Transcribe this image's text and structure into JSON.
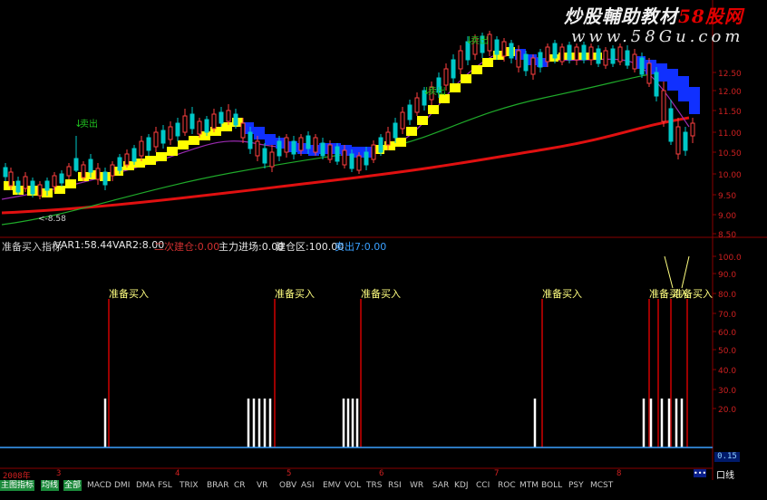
{
  "watermark": {
    "line1_white": "炒股輔助教材",
    "line1_red": "58股网",
    "line2": "www.58Gu.com"
  },
  "colors": {
    "up_candle": "#00c8c8",
    "down_candle": "#ff4040",
    "ma_red": "#e01010",
    "ma_green": "#1faa2a",
    "ma_purple": "#9a2ab0",
    "yellow_band": "#ffff00",
    "blue_band": "#1030ff",
    "signal_white": "#ffffff",
    "signal_red": "#d00000",
    "label_yellow": "#ffff80",
    "buy_green": "#20c020",
    "baseline": "#3aa0ff",
    "grid_red": "#8a0000"
  },
  "price_axis": [
    "12.50",
    "12.00",
    "11.50",
    "11.00",
    "10.50",
    "10.00",
    "9.50",
    "9.00",
    "8.50"
  ],
  "price_note": "<-8.58",
  "sell_labels": [
    "卖出",
    "卖出",
    "卖出"
  ],
  "indicator_header": {
    "title": "准备买入指标",
    "var1": "VAR1:58.44",
    "var2": "VAR2:8.00",
    "item3": "二次建仓:0.00",
    "item4": "主力进场:0.00",
    "item5": "建仓区:100.00",
    "item6": "卖出7:0.00"
  },
  "indicator_axis": [
    "100.0",
    "90.0",
    "80.0",
    "70.0",
    "60.0",
    "50.0",
    "40.0",
    "30.0",
    "20.0"
  ],
  "buy_labels": [
    "准备买入",
    "准备买入",
    "准备买入",
    "准备买入",
    "准备买入",
    "准备买入"
  ],
  "cursor_value": "0.15",
  "date_axis": {
    "year": "2008年",
    "months": [
      "3",
      "4",
      "5",
      "6",
      "7",
      "8"
    ]
  },
  "window_label": "口线",
  "scroll_button": "•••",
  "bottom_tabs": [
    "主图指标",
    "均线",
    "全部",
    "MACD",
    "DMI",
    "DMA",
    "FSL",
    "TRIX",
    "BRAR",
    "CR",
    "VR",
    "OBV",
    "ASI",
    "EMV",
    "VOL",
    "TRS",
    "RSI",
    "WR",
    "SAR",
    "KDJ",
    "CCI",
    "ROC",
    "MTM",
    "BOLL",
    "PSY",
    "MCST"
  ]
}
